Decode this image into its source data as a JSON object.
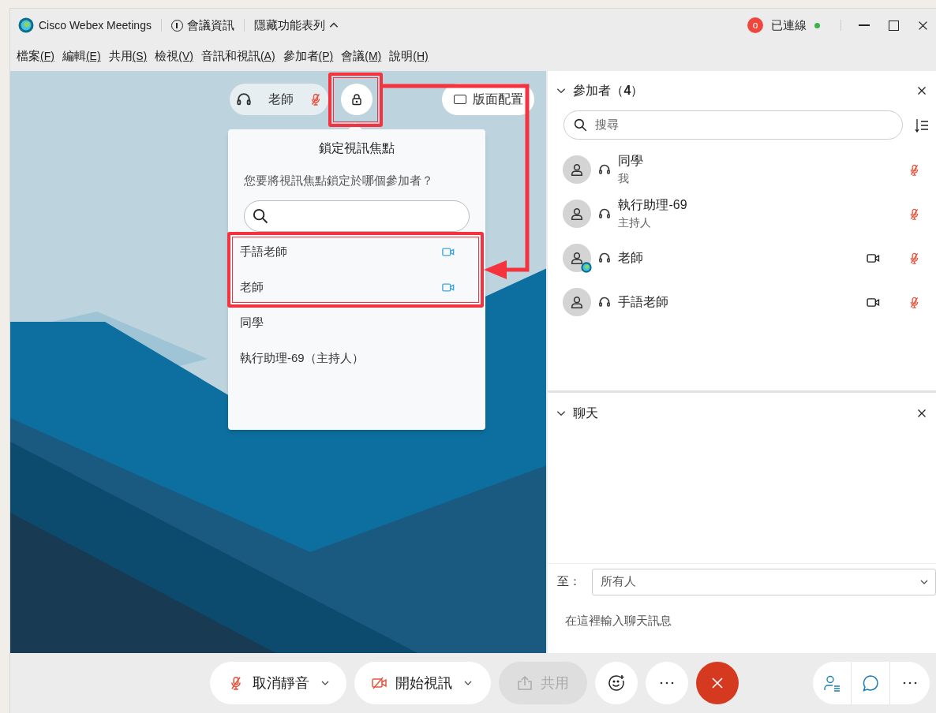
{
  "window": {
    "app_title": "Cisco Webex Meetings",
    "meeting_info": "會議資訊",
    "hide_menu": "隱藏功能表列",
    "notification_count": "o",
    "connection": "已連線",
    "connected": true
  },
  "menu": [
    {
      "label": "檔案",
      "accelerator": "(F)"
    },
    {
      "label": "編輯",
      "accelerator": "(E)"
    },
    {
      "label": "共用",
      "accelerator": "(S)"
    },
    {
      "label": "檢視",
      "accelerator": "(V)"
    },
    {
      "label": "音訊和視訊",
      "accelerator": "(A)"
    },
    {
      "label": "參加者",
      "accelerator": "(P)"
    },
    {
      "label": "會議",
      "accelerator": "(M)"
    },
    {
      "label": "說明",
      "accelerator": "(H)"
    }
  ],
  "video_area": {
    "active_speaker": {
      "name": "老師",
      "muted": true
    },
    "layout_button": "版面配置"
  },
  "lock_popup": {
    "title": "鎖定視訊焦點",
    "question": "您要將視訊焦點鎖定於哪個參加者？",
    "items": [
      {
        "label": "手語老師",
        "video": true
      },
      {
        "label": "老師",
        "video": true
      },
      {
        "label": "同學",
        "video": false
      },
      {
        "label": "執行助理-69（主持人）",
        "video": false
      }
    ]
  },
  "participants_panel": {
    "title": "參加者（**4**）",
    "expanded": true,
    "search_placeholder": "搜尋",
    "participants": [
      {
        "name": "同學",
        "role": "我",
        "presenter": false,
        "video": false,
        "muted": true
      },
      {
        "name": "執行助理-69",
        "role": "主持人",
        "presenter": false,
        "video": false,
        "muted": true
      },
      {
        "name": "老師",
        "presenter": true,
        "video": true,
        "muted": true
      },
      {
        "name": "手語老師",
        "presenter": false,
        "video": true,
        "muted": true
      }
    ]
  },
  "chat_panel": {
    "title": "聊天",
    "expanded": true,
    "to_label": "至：",
    "recipient": "所有人",
    "message_placeholder": "在這裡輸入聊天訊息"
  },
  "toolbar": {
    "unmute": "取消靜音",
    "start_video": "開始視訊",
    "share": {
      "label": "共用",
      "disabled": true
    }
  }
}
